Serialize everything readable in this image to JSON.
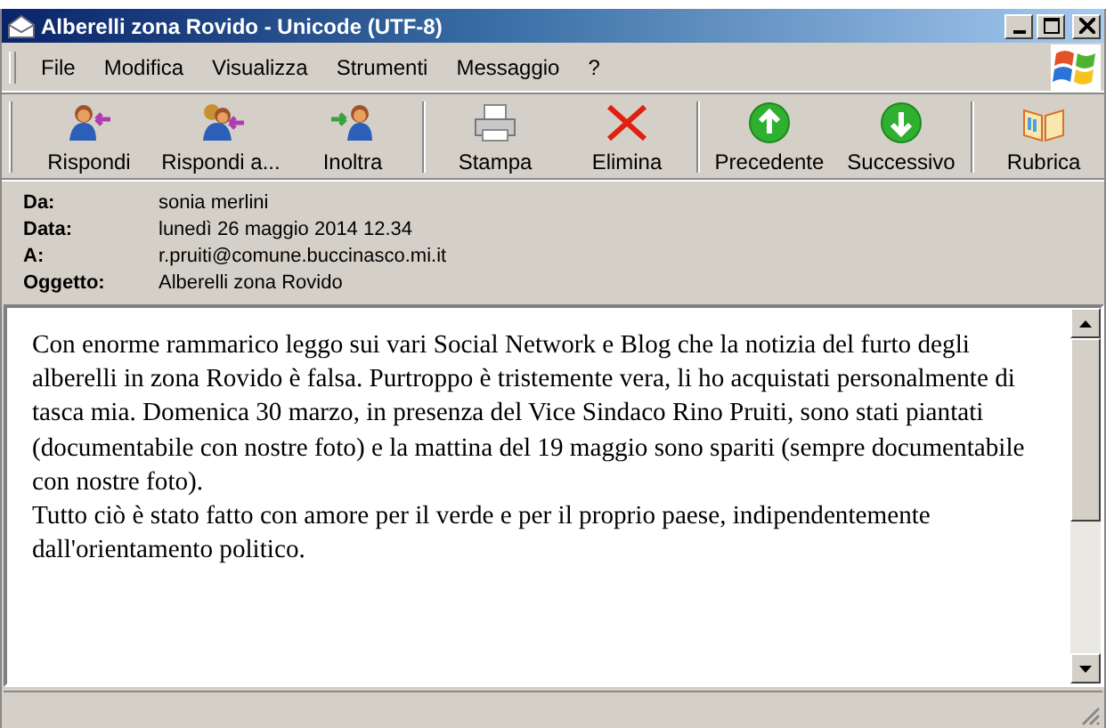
{
  "window": {
    "title": "Alberelli zona Rovido - Unicode (UTF-8)"
  },
  "menu": [
    "File",
    "Modifica",
    "Visualizza",
    "Strumenti",
    "Messaggio",
    "?"
  ],
  "toolbar": [
    [
      {
        "label": "Rispondi",
        "kind": "reply"
      },
      {
        "label": "Rispondi a...",
        "kind": "reply-all"
      },
      {
        "label": "Inoltra",
        "kind": "forward"
      }
    ],
    [
      {
        "label": "Stampa",
        "kind": "print"
      },
      {
        "label": "Elimina",
        "kind": "delete"
      }
    ],
    [
      {
        "label": "Precedente",
        "kind": "up"
      },
      {
        "label": "Successivo",
        "kind": "down"
      }
    ],
    [
      {
        "label": "Rubrica",
        "kind": "book"
      }
    ]
  ],
  "header": [
    {
      "label": "Da:",
      "value": "sonia merlini"
    },
    {
      "label": "Data:",
      "value": "lunedì 26 maggio 2014 12.34"
    },
    {
      "label": "A:",
      "value": "r.pruiti@comune.buccinasco.mi.it"
    },
    {
      "label": "Oggetto:",
      "value": "Alberelli zona Rovido"
    }
  ],
  "body": [
    "Con enorme rammarico leggo sui vari Social Network e Blog che la notizia del furto degli alberelli in zona Rovido è falsa. Purtroppo è tristemente vera, li ho acquistati personalmente di tasca mia. Domenica 30 marzo, in presenza del Vice Sindaco Rino Pruiti, sono stati piantati (documentabile con nostre foto) e la mattina del 19 maggio sono spariti (sempre documentabile con nostre foto).",
    "Tutto ciò è stato fatto con amore per il verde e per il proprio paese, indipendentemente dall'orientamento politico."
  ]
}
